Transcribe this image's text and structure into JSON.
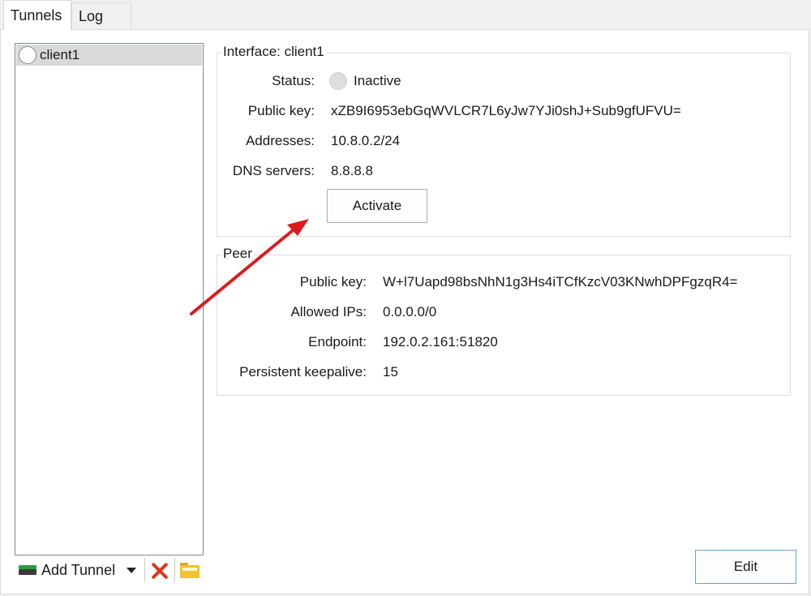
{
  "tabs": [
    {
      "label": "Tunnels",
      "active": true
    },
    {
      "label": "Log",
      "active": false
    }
  ],
  "tunnel_list": {
    "items": [
      {
        "name": "client1",
        "status": "inactive"
      }
    ]
  },
  "list_toolbar": {
    "add_label": "Add Tunnel",
    "delete_icon": "delete-icon",
    "export_icon": "folder-icon"
  },
  "interface": {
    "title": "Interface: client1",
    "status_label": "Status:",
    "status_value": "Inactive",
    "public_key_label": "Public key:",
    "public_key_value": "xZB9I6953ebGqWVLCR7L6yJw7YJi0shJ+Sub9gfUFVU=",
    "addresses_label": "Addresses:",
    "addresses_value": "10.8.0.2/24",
    "dns_label": "DNS servers:",
    "dns_value": "8.8.8.8",
    "activate_label": "Activate"
  },
  "peer": {
    "title": "Peer",
    "public_key_label": "Public key:",
    "public_key_value": "W+l7Uapd98bsNhN1g3Hs4iTCfKzcV03KNwhDPFgzqR4=",
    "allowed_ips_label": "Allowed IPs:",
    "allowed_ips_value": "0.0.0.0/0",
    "endpoint_label": "Endpoint:",
    "endpoint_value": "192.0.2.161:51820",
    "keepalive_label": "Persistent keepalive:",
    "keepalive_value": "15"
  },
  "edit_label": "Edit",
  "colors": {
    "annotation_arrow": "#d81e1e",
    "selection": "#d9d9d9",
    "delete": "#d9381e"
  }
}
